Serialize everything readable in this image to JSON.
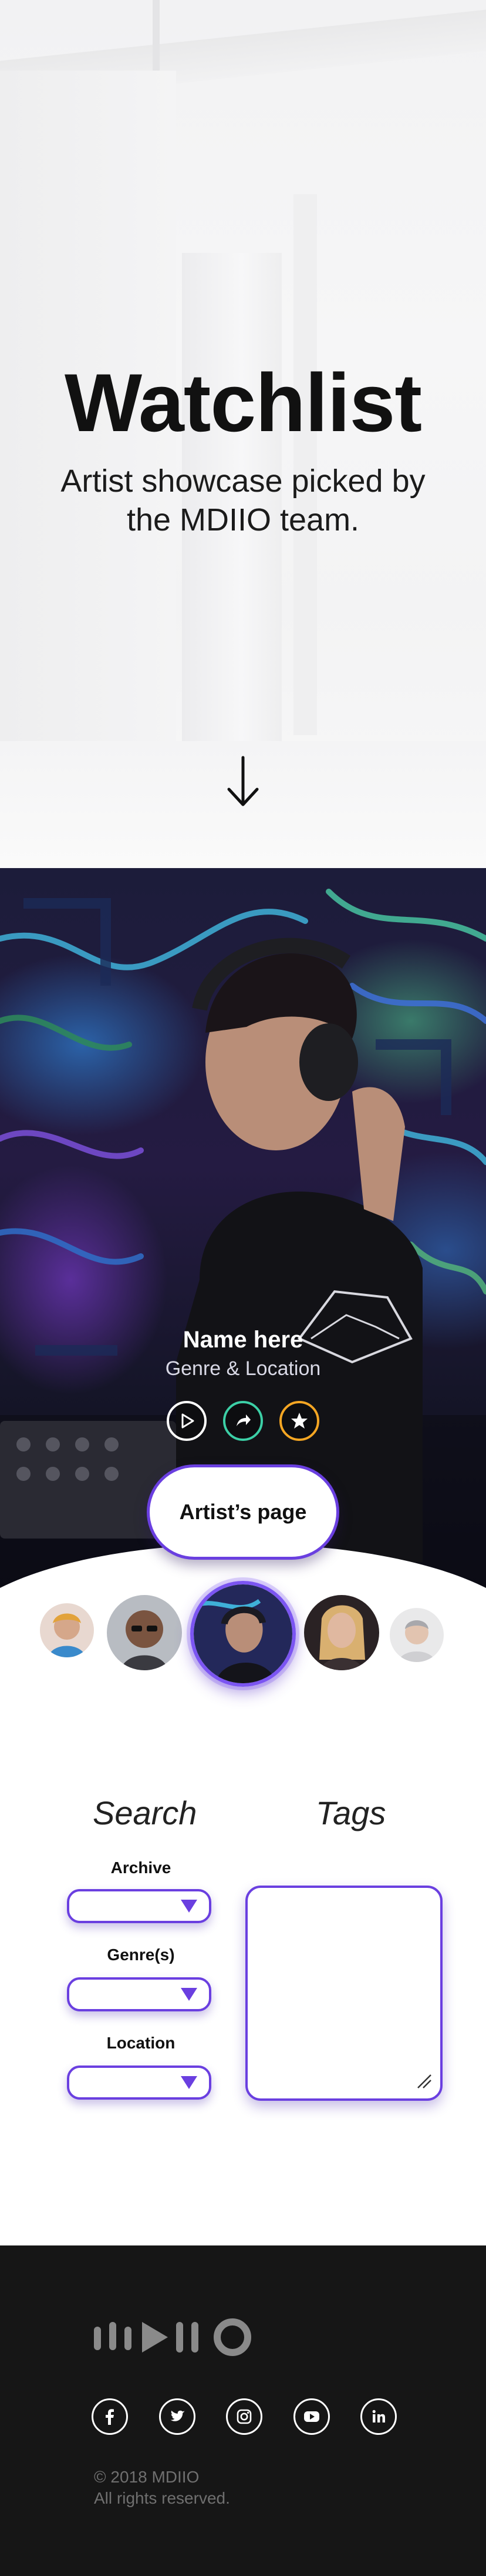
{
  "hero": {
    "title": "Watchlist",
    "subtitle_line1": "Artist showcase picked by",
    "subtitle_line2": "the MDIIO team.",
    "scroll_icon": "arrow-down-icon"
  },
  "featured": {
    "name": "Name here",
    "genre_location": "Genre & Location",
    "actions": [
      {
        "icon": "play-icon",
        "color": "#ffffff"
      },
      {
        "icon": "share-icon",
        "color": "#3ccfa6"
      },
      {
        "icon": "star-icon",
        "color": "#f5a623"
      }
    ],
    "artist_button": "Artist’s page"
  },
  "carousel": {
    "avatars": [
      "artist-avatar-1",
      "artist-avatar-2",
      "artist-avatar-3-selected",
      "artist-avatar-4",
      "artist-avatar-5"
    ],
    "selected": 3
  },
  "search": {
    "title": "Search",
    "fields": [
      {
        "label": "Archive",
        "value": ""
      },
      {
        "label": "Genre(s)",
        "value": ""
      },
      {
        "label": "Location",
        "value": ""
      }
    ]
  },
  "tags": {
    "title": "Tags",
    "value": ""
  },
  "footer": {
    "logo_icon": "mdiio-logo",
    "socials": [
      "facebook-icon",
      "twitter-icon",
      "instagram-icon",
      "youtube-icon",
      "linkedin-icon"
    ],
    "copyright_line1": "© 2018 MDIIO",
    "copyright_line2": "All rights reserved."
  },
  "colors": {
    "accent": "#6a3fe0",
    "footer_bg": "#161616",
    "share": "#3ccfa6",
    "star": "#f5a623"
  }
}
